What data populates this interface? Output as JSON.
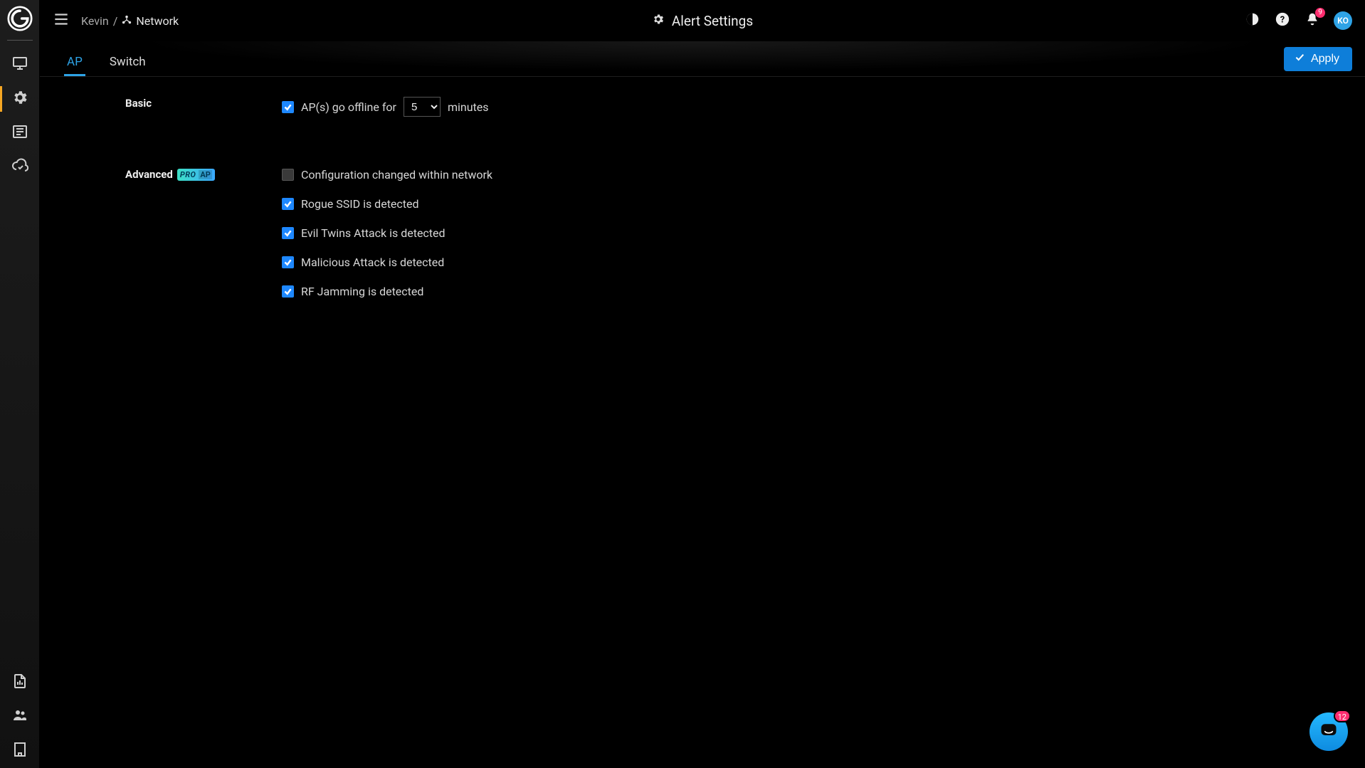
{
  "header": {
    "breadcrumb": {
      "user": "Kevin",
      "sep": "/",
      "network": "Network"
    },
    "title": "Alert Settings",
    "bell_count": "9",
    "avatar_initials": "KO"
  },
  "subheader": {
    "tabs": {
      "ap": "AP",
      "switch": "Switch"
    },
    "apply_label": "Apply"
  },
  "sections": {
    "basic": {
      "label": "Basic",
      "offline_pre": "AP(s) go offline for",
      "offline_post": "minutes",
      "offline_value": "5"
    },
    "advanced": {
      "label": "Advanced",
      "badge_pro": "PRO",
      "badge_ap": "AP",
      "items": {
        "cfg": "Configuration changed within network",
        "rogue": "Rogue SSID is detected",
        "evil": "Evil Twins Attack is detected",
        "malicious": "Malicious Attack is detected",
        "rf": "RF Jamming is detected"
      }
    }
  },
  "chat": {
    "count": "12"
  }
}
